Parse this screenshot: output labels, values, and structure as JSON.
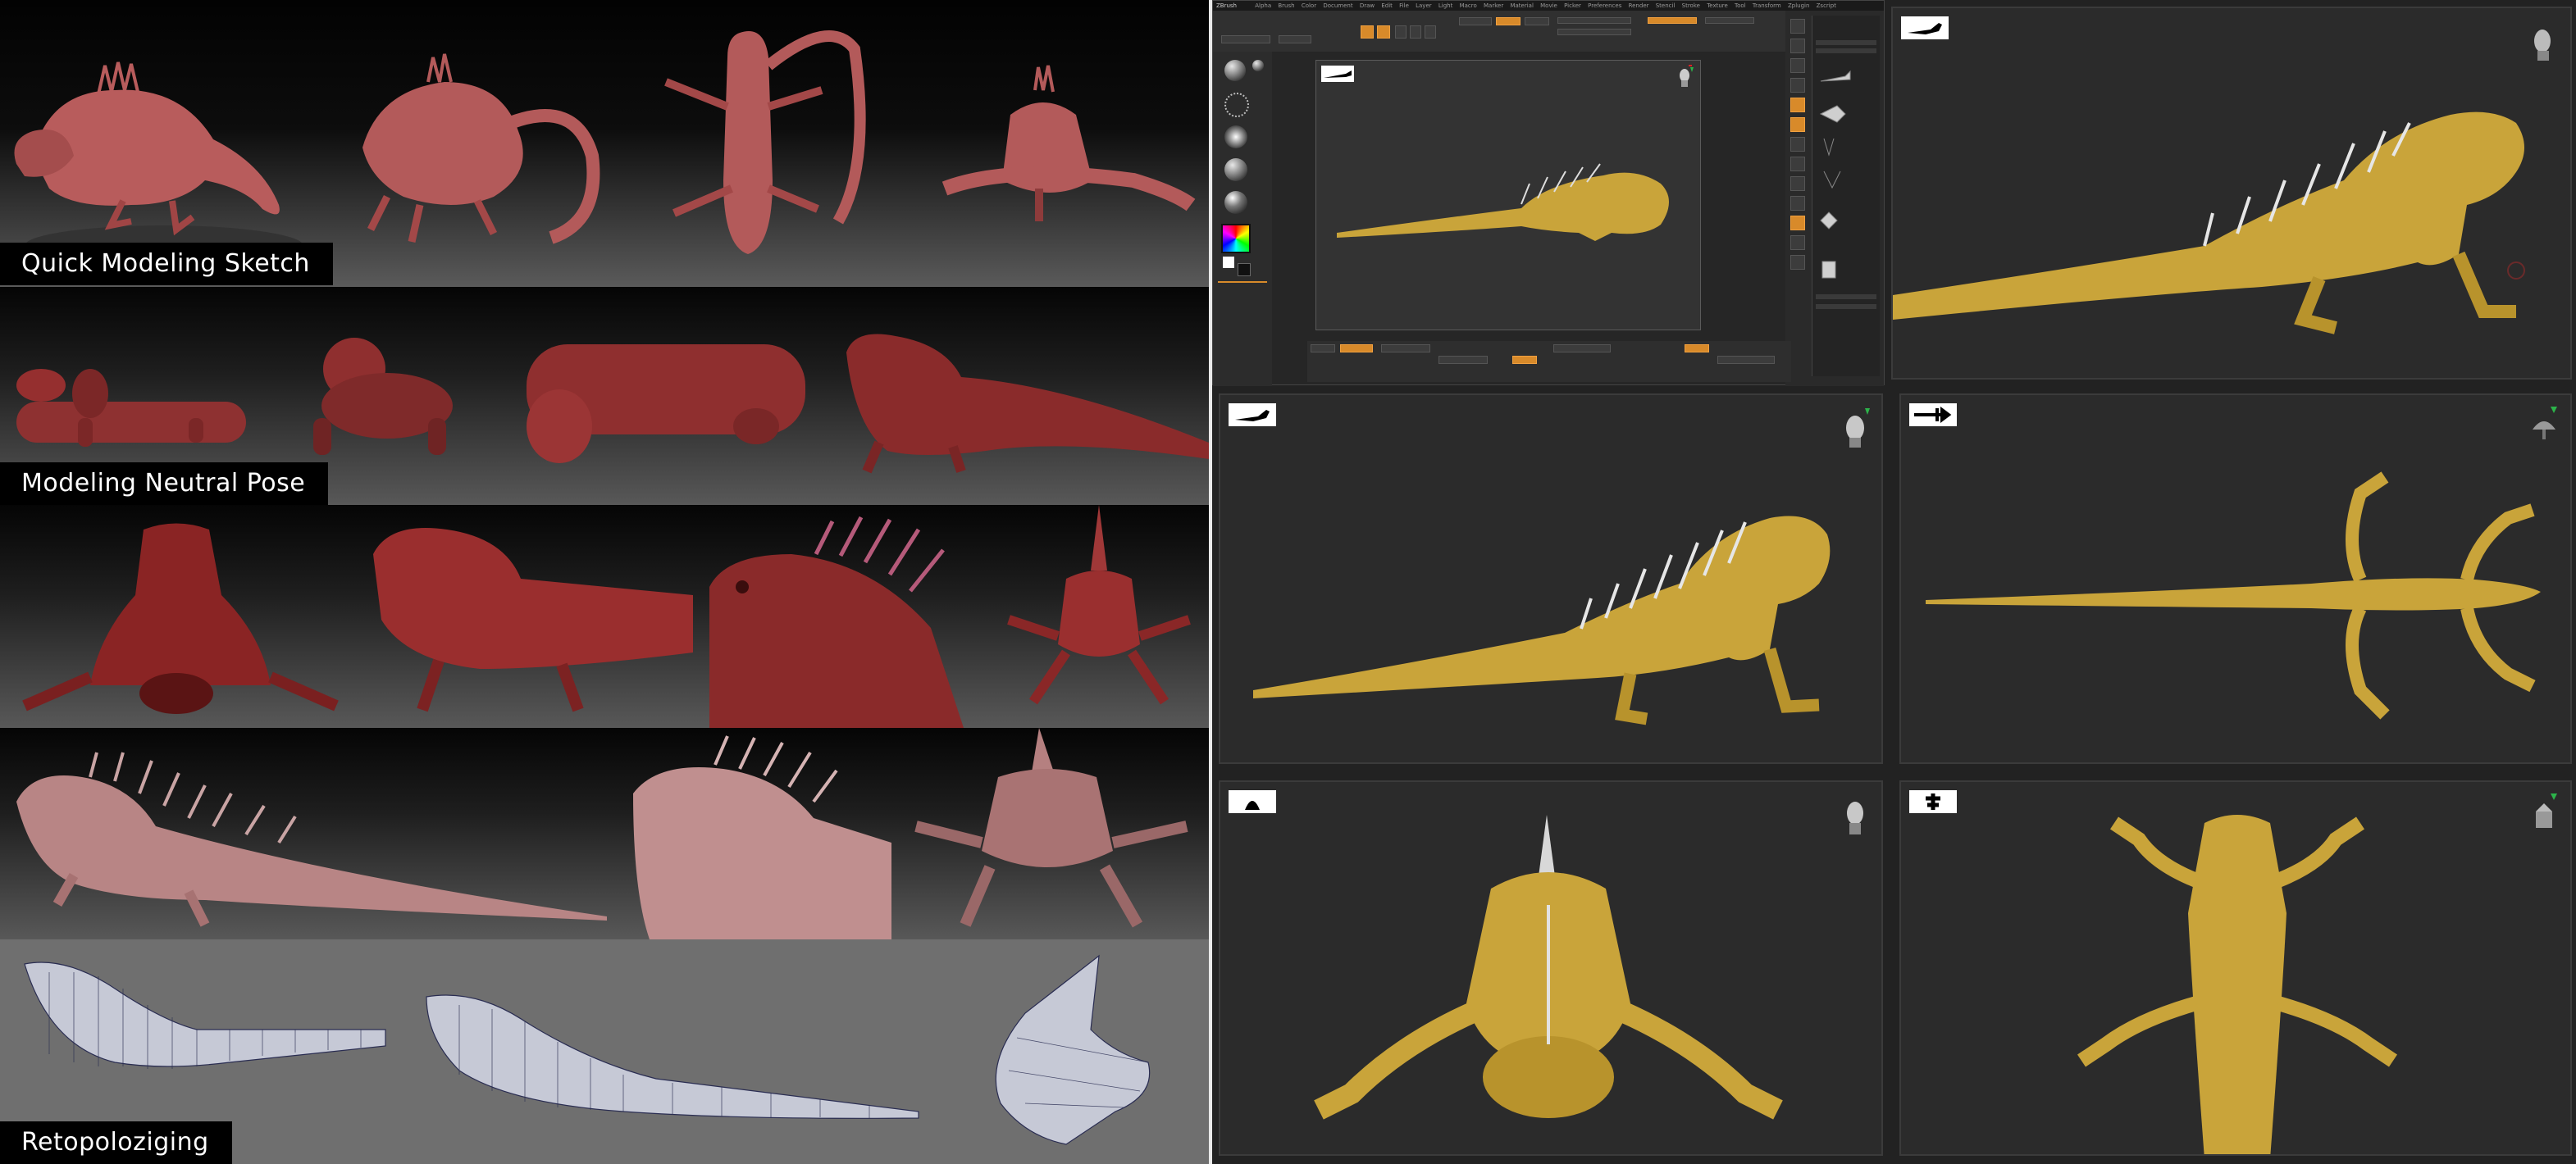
{
  "collage": {
    "sections": [
      {
        "label": "Quick Modeling Sketch"
      },
      {
        "label": "Modeling Neutral Pose"
      },
      {
        "label": ""
      },
      {
        "label": ""
      },
      {
        "label": "Retopoloziging"
      }
    ]
  },
  "zbrush": {
    "app_title": "ZBrush",
    "menu_items": [
      "Alpha",
      "Brush",
      "Color",
      "Document",
      "Draw",
      "Edit",
      "File",
      "Layer",
      "Light",
      "Macro",
      "Marker",
      "Material",
      "Movie",
      "Picker",
      "Preferences",
      "Render",
      "Stencil",
      "Stroke",
      "Texture",
      "Tool",
      "Transform",
      "Zplugin",
      "Zscript"
    ],
    "tool_buttons": [
      "Edit",
      "Draw",
      "Move",
      "Scale",
      "Rotate"
    ]
  },
  "viewports": [
    {
      "view": "side-right",
      "camera_icon": "camera-side-icon"
    },
    {
      "view": "side-left",
      "camera_icon": "camera-side-icon"
    },
    {
      "view": "top",
      "camera_icon": "camera-top-icon"
    },
    {
      "view": "front",
      "camera_icon": "camera-front-icon"
    },
    {
      "view": "bottom",
      "camera_icon": "camera-bottom-icon"
    }
  ],
  "colors": {
    "clay_red": "#8a2f2f",
    "clay_pink": "#c48a8a",
    "wire_gray": "#b8bccc",
    "gold": "#c9a43a",
    "zbrush_orange": "#d88a2a"
  }
}
